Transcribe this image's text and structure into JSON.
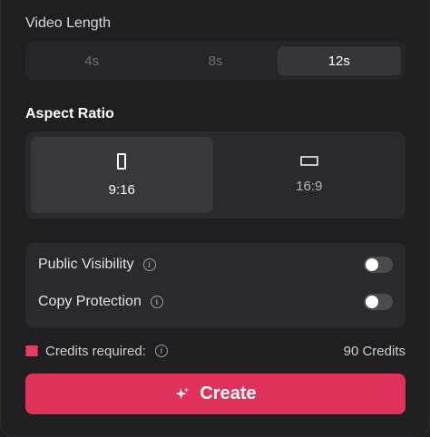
{
  "video_length": {
    "label": "Video Length",
    "options": [
      "4s",
      "8s",
      "12s"
    ],
    "selected": "12s"
  },
  "aspect_ratio": {
    "label": "Aspect Ratio",
    "options": [
      "9:16",
      "16:9"
    ],
    "selected": "9:16"
  },
  "toggles": [
    {
      "label": "Public Visibility",
      "enabled": false
    },
    {
      "label": "Copy Protection",
      "enabled": false
    }
  ],
  "credits": {
    "label": "Credits required:",
    "value": "90 Credits"
  },
  "create_button": {
    "label": "Create"
  },
  "icons": {
    "info": "info-icon",
    "coins": "coin-stack-icon",
    "sparkle": "sparkle-icon",
    "portrait": "portrait-ratio-icon",
    "landscape": "landscape-ratio-icon"
  },
  "colors": {
    "accent": "#e0315a",
    "coin": "#e83b62"
  }
}
